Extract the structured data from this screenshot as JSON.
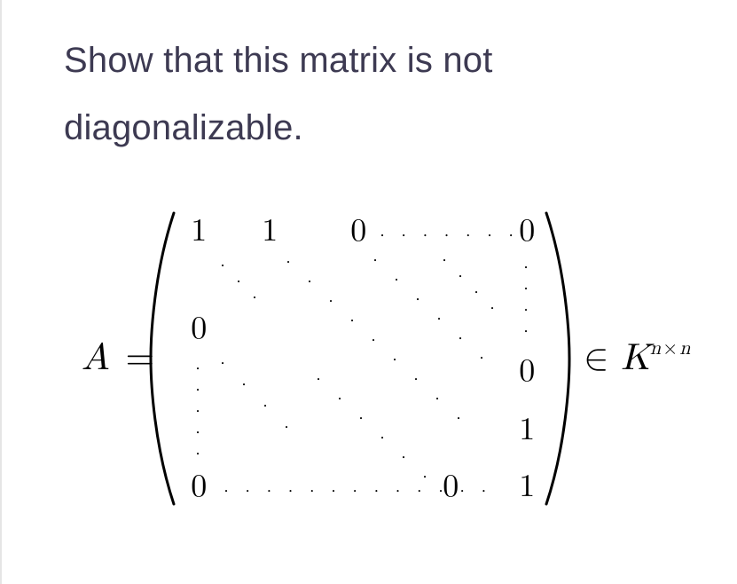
{
  "problem": {
    "text": "Show that this matrix is not diagonalizable."
  },
  "equation": {
    "lhs": "A",
    "equals": "=",
    "rhs_element": "∈",
    "rhs_set": "K",
    "rhs_exp_n1": "n",
    "rhs_exp_times": "×",
    "rhs_exp_n2": "n"
  },
  "matrix": {
    "topRow": {
      "c0": "1",
      "c1": "1",
      "c2": "0",
      "cN": "0"
    },
    "col0": {
      "r1": "0",
      "rN": "0"
    },
    "colN": {
      "r_mid": "0",
      "r_nm1": "1",
      "rN": "1"
    },
    "bottomRow": {
      "c_nm1": "0"
    }
  }
}
